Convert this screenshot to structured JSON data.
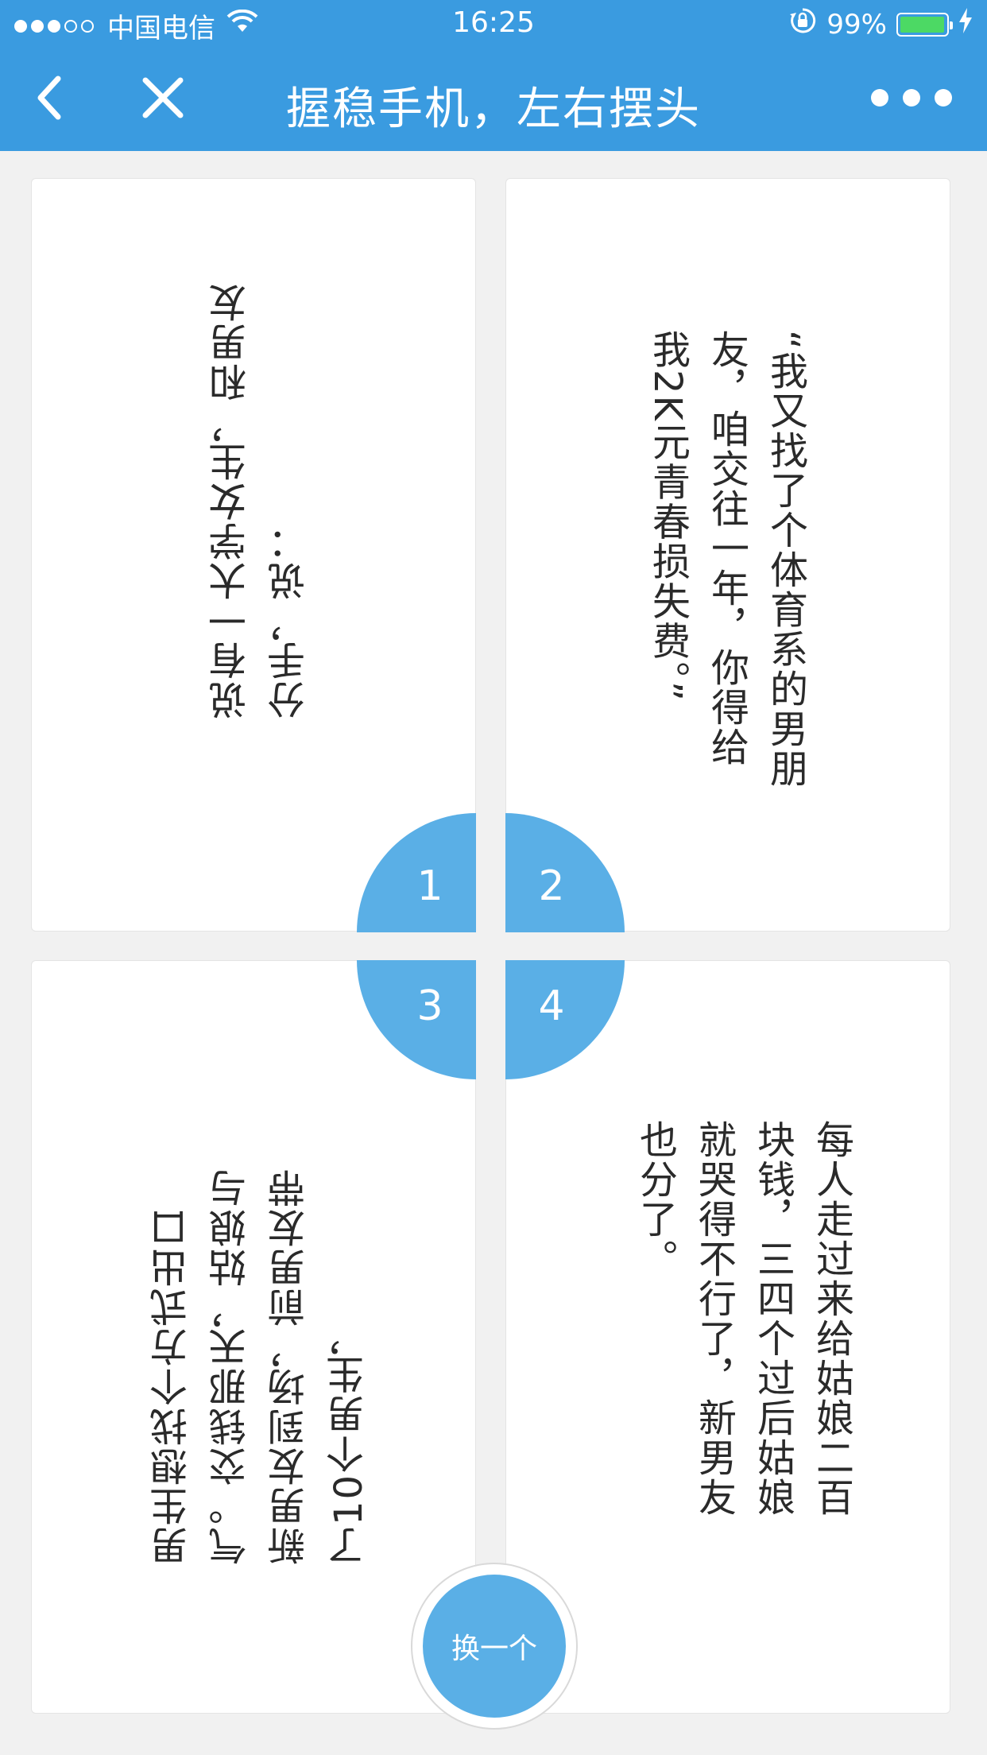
{
  "status_bar": {
    "signal_full": 3,
    "signal_total": 5,
    "carrier": "中国电信",
    "time": "16:25",
    "battery_percent": "99%",
    "battery_level": 0.99,
    "icons": [
      "wifi-icon",
      "orientation-lock-icon",
      "battery-icon",
      "charging-bolt-icon"
    ]
  },
  "nav": {
    "title": "握稳手机，左右摆头",
    "icons": [
      "back-chevron-icon",
      "close-icon",
      "more-dots-icon"
    ]
  },
  "cards": [
    {
      "number": "1",
      "text": "说有一大学女生，和男友分手，说："
    },
    {
      "number": "2",
      "text": "“我又找了个体育系的男朋友，咱交往一年，你得给我2K元青春损失费。”"
    },
    {
      "number": "3",
      "text": "男生想找个方式出口气。交钱那天，姑娘与新男友到场，前男友带了10个男生，"
    },
    {
      "number": "4",
      "text": "每人走过来给姑娘二百块钱，三四个过后姑娘就哭得不行了，新男友也分了。"
    }
  ],
  "change_button": {
    "label": "换一个"
  },
  "colors": {
    "primary": "#3a9be0",
    "accent": "#5aafe6",
    "background": "#f1f1f1",
    "battery": "#4cd964"
  }
}
